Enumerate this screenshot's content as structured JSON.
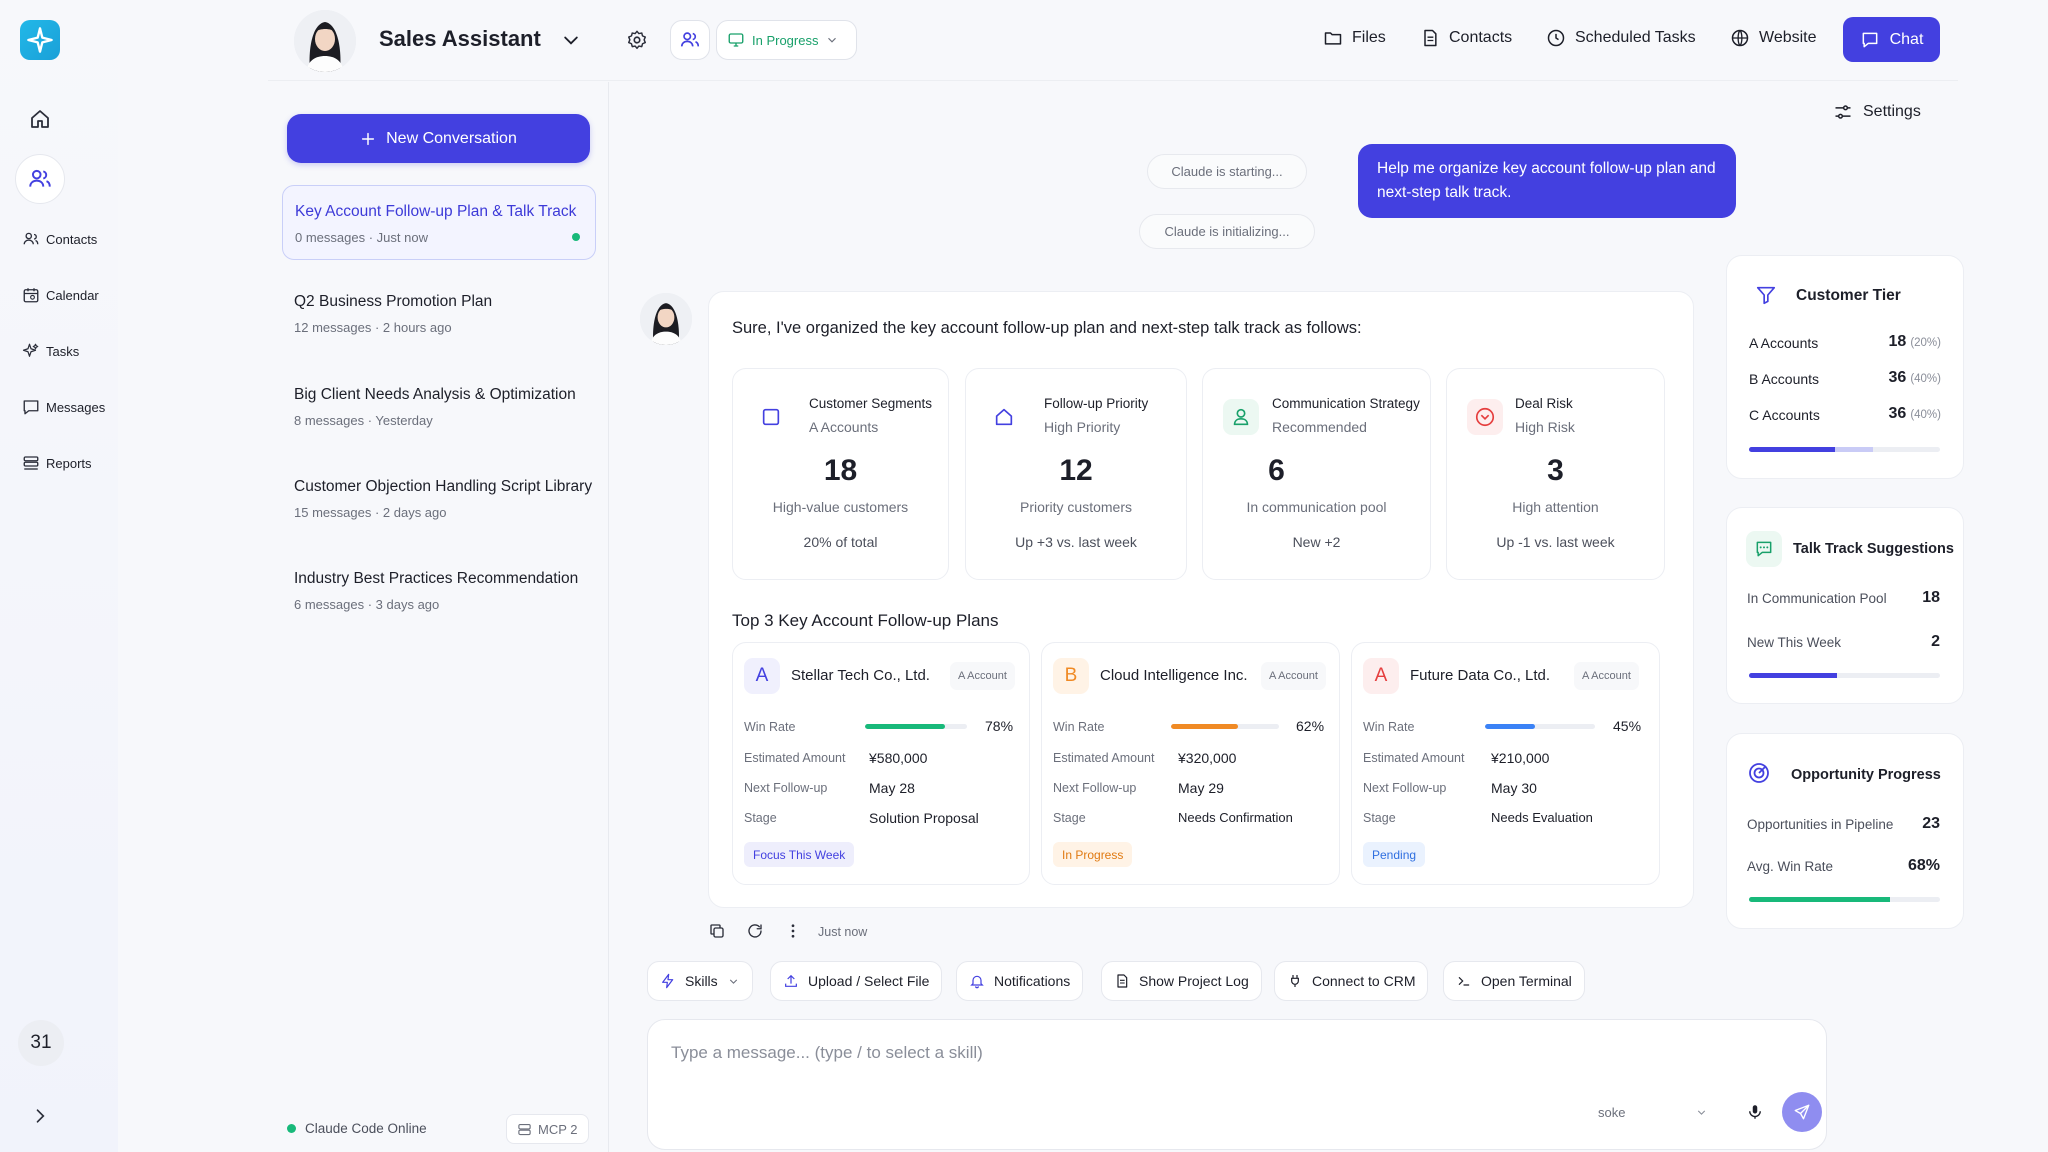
{
  "header": {
    "title": "Sales Assistant",
    "status": "In Progress",
    "links": [
      "Files",
      "Contacts",
      "Scheduled Tasks",
      "Website"
    ],
    "chat_label": "Chat",
    "settings_label": "Settings"
  },
  "rail": {
    "items": [
      "Contacts",
      "Calendar",
      "Tasks",
      "Messages",
      "Reports"
    ],
    "badge": "31"
  },
  "sidebar": {
    "new_conversation": "New Conversation",
    "conversations": [
      {
        "title": "Key Account Follow-up Plan & Talk Track",
        "count": "0 messages",
        "time": "Just now"
      },
      {
        "title": "Q2 Business Promotion Plan",
        "count": "12 messages",
        "time": "2 hours ago"
      },
      {
        "title": "Big Client Needs Analysis & Optimization",
        "count": "8 messages",
        "time": "Yesterday"
      },
      {
        "title": "Customer Objection Handling Script Library",
        "count": "15 messages",
        "time": "2 days ago"
      },
      {
        "title": "Industry Best Practices Recommendation",
        "count": "6 messages",
        "time": "3 days ago"
      }
    ],
    "footer_status": "Claude Code Online",
    "mcp": "MCP 2"
  },
  "chat": {
    "system_1": "Claude is starting...",
    "system_2": "Claude is initializing...",
    "user_message": "Help me organize key account follow-up plan and next-step talk track.",
    "assistant_intro": "Sure, I've organized the key account follow-up plan and next-step talk track as follows:",
    "stats": [
      {
        "label": "Customer Segments",
        "sub": "A Accounts",
        "value": "18",
        "desc": "High-value customers",
        "foot": "20% of total"
      },
      {
        "label": "Follow-up Priority",
        "sub": "High Priority",
        "value": "12",
        "desc": "Priority customers",
        "foot": "Up +3 vs. last week"
      },
      {
        "label": "Communication Strategy",
        "sub": "Recommended",
        "value": "6",
        "desc": "In communication pool",
        "foot": "New +2"
      },
      {
        "label": "Deal Risk",
        "sub": "High Risk",
        "value": "3",
        "desc": "High attention",
        "foot": "Up -1 vs. last week"
      }
    ],
    "plans_title": "Top 3 Key Account Follow-up Plans",
    "field_labels": {
      "win_rate": "Win Rate",
      "amount": "Estimated Amount",
      "next": "Next Follow-up",
      "stage": "Stage"
    },
    "accounts": [
      {
        "letter": "A",
        "name": "Stellar Tech Co., Ltd.",
        "tag": "A Account",
        "win_rate": "78%",
        "win_value": 0.78,
        "amount": "¥580,000",
        "next": "May 28",
        "stage": "Solution Proposal",
        "status": "Focus This Week",
        "color": "#18b97a"
      },
      {
        "letter": "B",
        "name": "Cloud Intelligence Inc.",
        "tag": "A Account",
        "win_rate": "62%",
        "win_value": 0.62,
        "amount": "¥320,000",
        "next": "May 29",
        "stage": "Needs Confirmation",
        "status": "In Progress",
        "color": "#f08a24"
      },
      {
        "letter": "A",
        "name": "Future Data Co., Ltd.",
        "tag": "A Account",
        "win_rate": "45%",
        "win_value": 0.45,
        "amount": "¥210,000",
        "next": "May 30",
        "stage": "Needs Evaluation",
        "status": "Pending",
        "color": "#3b82f6"
      }
    ],
    "timestamp": "Just now"
  },
  "right": {
    "tier": {
      "title": "Customer Tier",
      "rows": [
        {
          "label": "A Accounts",
          "value": "18",
          "pct": "(20%)"
        },
        {
          "label": "B Accounts",
          "value": "36",
          "pct": "(40%)"
        },
        {
          "label": "C Accounts",
          "value": "36",
          "pct": "(40%)"
        }
      ]
    },
    "talk": {
      "title": "Talk Track Suggestions",
      "rows": [
        {
          "label": "In Communication Pool",
          "value": "18"
        },
        {
          "label": "New This Week",
          "value": "2"
        }
      ],
      "progress": 0.46
    },
    "opp": {
      "title": "Opportunity Progress",
      "rows": [
        {
          "label": "Opportunities in Pipeline",
          "value": "23"
        },
        {
          "label": "Avg. Win Rate",
          "value": "68%"
        }
      ],
      "progress": 0.74
    }
  },
  "toolbar": [
    "Skills",
    "Upload / Select File",
    "Notifications",
    "Show Project Log",
    "Connect to CRM",
    "Open Terminal"
  ],
  "composer": {
    "placeholder": "Type a message... (type / to select a skill)",
    "model": "soke"
  }
}
